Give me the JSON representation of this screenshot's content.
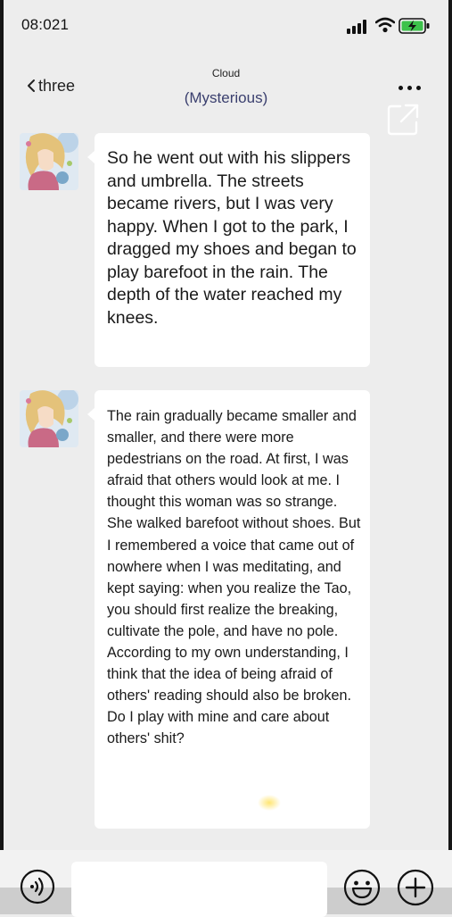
{
  "status_bar": {
    "time": "08:021"
  },
  "nav": {
    "back_label": "three",
    "subtitle": "Cloud",
    "title": "(Mysterious)"
  },
  "messages": [
    {
      "sender": "avatar",
      "text": "So he went out with his slippers and umbrella. The streets became rivers, but I was very happy. When I got to the park, I dragged my shoes and began to play barefoot in the rain. The depth of the water reached my knees."
    },
    {
      "sender": "avatar",
      "text": "The rain gradually became smaller and smaller, and there were more pedestrians on the road. At first, I was afraid that others would look at me. I thought this woman was so strange. She walked barefoot without shoes. But I remembered a voice that came out of nowhere when I was meditating, and kept saying: when you realize the Tao, you should first realize the breaking, cultivate the pole, and have no pole. According to my own understanding, I think that the idea of being afraid of others' reading should also be broken. Do I play with mine and care about others' shit?"
    }
  ],
  "input_bar": {
    "value": "",
    "placeholder": ""
  },
  "icons": [
    "signal-icon",
    "wifi-icon",
    "battery-charging-icon",
    "chevron-left-icon",
    "more-icon",
    "share-icon",
    "voice-icon",
    "emoji-icon",
    "plus-icon"
  ],
  "colors": {
    "background": "#ededed",
    "bubble": "#ffffff",
    "title": "#3a3f6e",
    "battery": "#3cc24a"
  }
}
